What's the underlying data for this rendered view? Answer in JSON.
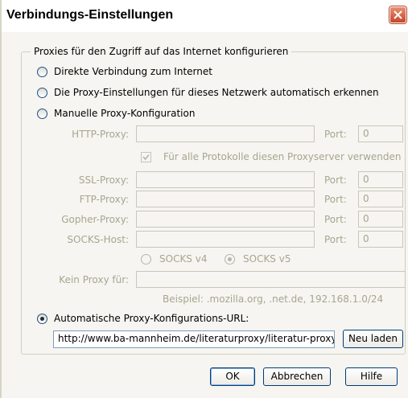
{
  "window": {
    "title": "Verbindungs-Einstellungen"
  },
  "group": {
    "legend": "Proxies für den Zugriff auf das Internet konfigurieren"
  },
  "options": {
    "direct": "Direkte Verbindung zum Internet",
    "auto_detect": "Die Proxy-Einstellungen für dieses Netzwerk automatisch erkennen",
    "manual": "Manuelle Proxy-Konfiguration",
    "auto_url": "Automatische Proxy-Konfigurations-URL:"
  },
  "manual": {
    "http_label": "HTTP-Proxy:",
    "port_label": "Port:",
    "http_port": "0",
    "same_proxy_label": "Für alle Protokolle diesen Proxyserver verwenden",
    "ssl_label": "SSL-Proxy:",
    "ssl_port": "0",
    "ftp_label": "FTP-Proxy:",
    "ftp_port": "0",
    "gopher_label": "Gopher-Proxy:",
    "gopher_port": "0",
    "socks_label": "SOCKS-Host:",
    "socks_port": "0",
    "socks_v4": "SOCKS v4",
    "socks_v5": "SOCKS v5",
    "no_proxy_label": "Kein Proxy für:",
    "no_proxy_example": "Beispiel: .mozilla.org, .net.de, 192.168.1.0/24"
  },
  "auto": {
    "url_value": "http://www.ba-mannheim.de/literaturproxy/literatur-proxy.pac",
    "reload_button": "Neu laden"
  },
  "buttons": {
    "ok": "OK",
    "cancel": "Abbrechen",
    "help": "Hilfe"
  }
}
